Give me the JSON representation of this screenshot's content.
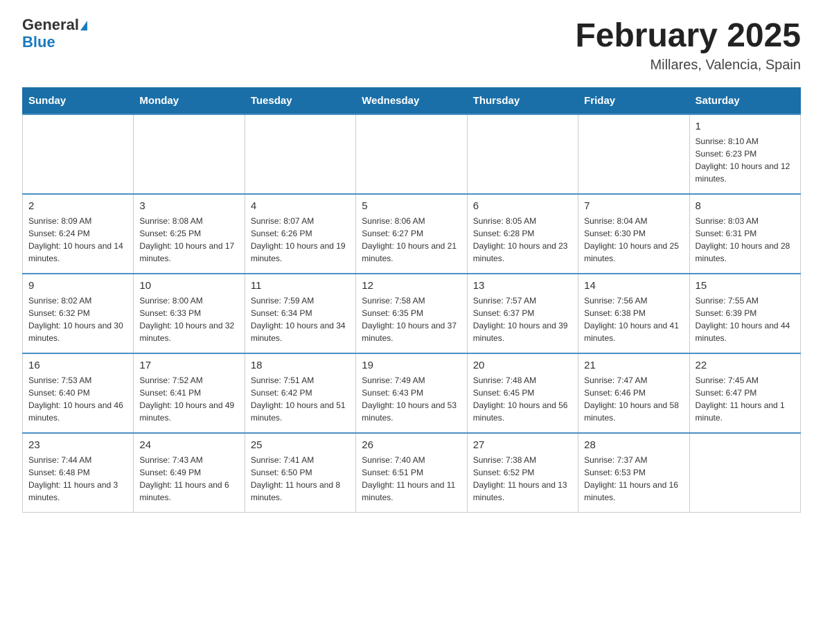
{
  "logo": {
    "line1": "General",
    "line2": "Blue"
  },
  "title": "February 2025",
  "location": "Millares, Valencia, Spain",
  "days_of_week": [
    "Sunday",
    "Monday",
    "Tuesday",
    "Wednesday",
    "Thursday",
    "Friday",
    "Saturday"
  ],
  "weeks": [
    [
      {
        "day": null,
        "sunrise": null,
        "sunset": null,
        "daylight": null
      },
      {
        "day": null,
        "sunrise": null,
        "sunset": null,
        "daylight": null
      },
      {
        "day": null,
        "sunrise": null,
        "sunset": null,
        "daylight": null
      },
      {
        "day": null,
        "sunrise": null,
        "sunset": null,
        "daylight": null
      },
      {
        "day": null,
        "sunrise": null,
        "sunset": null,
        "daylight": null
      },
      {
        "day": null,
        "sunrise": null,
        "sunset": null,
        "daylight": null
      },
      {
        "day": "1",
        "sunrise": "Sunrise: 8:10 AM",
        "sunset": "Sunset: 6:23 PM",
        "daylight": "Daylight: 10 hours and 12 minutes."
      }
    ],
    [
      {
        "day": "2",
        "sunrise": "Sunrise: 8:09 AM",
        "sunset": "Sunset: 6:24 PM",
        "daylight": "Daylight: 10 hours and 14 minutes."
      },
      {
        "day": "3",
        "sunrise": "Sunrise: 8:08 AM",
        "sunset": "Sunset: 6:25 PM",
        "daylight": "Daylight: 10 hours and 17 minutes."
      },
      {
        "day": "4",
        "sunrise": "Sunrise: 8:07 AM",
        "sunset": "Sunset: 6:26 PM",
        "daylight": "Daylight: 10 hours and 19 minutes."
      },
      {
        "day": "5",
        "sunrise": "Sunrise: 8:06 AM",
        "sunset": "Sunset: 6:27 PM",
        "daylight": "Daylight: 10 hours and 21 minutes."
      },
      {
        "day": "6",
        "sunrise": "Sunrise: 8:05 AM",
        "sunset": "Sunset: 6:28 PM",
        "daylight": "Daylight: 10 hours and 23 minutes."
      },
      {
        "day": "7",
        "sunrise": "Sunrise: 8:04 AM",
        "sunset": "Sunset: 6:30 PM",
        "daylight": "Daylight: 10 hours and 25 minutes."
      },
      {
        "day": "8",
        "sunrise": "Sunrise: 8:03 AM",
        "sunset": "Sunset: 6:31 PM",
        "daylight": "Daylight: 10 hours and 28 minutes."
      }
    ],
    [
      {
        "day": "9",
        "sunrise": "Sunrise: 8:02 AM",
        "sunset": "Sunset: 6:32 PM",
        "daylight": "Daylight: 10 hours and 30 minutes."
      },
      {
        "day": "10",
        "sunrise": "Sunrise: 8:00 AM",
        "sunset": "Sunset: 6:33 PM",
        "daylight": "Daylight: 10 hours and 32 minutes."
      },
      {
        "day": "11",
        "sunrise": "Sunrise: 7:59 AM",
        "sunset": "Sunset: 6:34 PM",
        "daylight": "Daylight: 10 hours and 34 minutes."
      },
      {
        "day": "12",
        "sunrise": "Sunrise: 7:58 AM",
        "sunset": "Sunset: 6:35 PM",
        "daylight": "Daylight: 10 hours and 37 minutes."
      },
      {
        "day": "13",
        "sunrise": "Sunrise: 7:57 AM",
        "sunset": "Sunset: 6:37 PM",
        "daylight": "Daylight: 10 hours and 39 minutes."
      },
      {
        "day": "14",
        "sunrise": "Sunrise: 7:56 AM",
        "sunset": "Sunset: 6:38 PM",
        "daylight": "Daylight: 10 hours and 41 minutes."
      },
      {
        "day": "15",
        "sunrise": "Sunrise: 7:55 AM",
        "sunset": "Sunset: 6:39 PM",
        "daylight": "Daylight: 10 hours and 44 minutes."
      }
    ],
    [
      {
        "day": "16",
        "sunrise": "Sunrise: 7:53 AM",
        "sunset": "Sunset: 6:40 PM",
        "daylight": "Daylight: 10 hours and 46 minutes."
      },
      {
        "day": "17",
        "sunrise": "Sunrise: 7:52 AM",
        "sunset": "Sunset: 6:41 PM",
        "daylight": "Daylight: 10 hours and 49 minutes."
      },
      {
        "day": "18",
        "sunrise": "Sunrise: 7:51 AM",
        "sunset": "Sunset: 6:42 PM",
        "daylight": "Daylight: 10 hours and 51 minutes."
      },
      {
        "day": "19",
        "sunrise": "Sunrise: 7:49 AM",
        "sunset": "Sunset: 6:43 PM",
        "daylight": "Daylight: 10 hours and 53 minutes."
      },
      {
        "day": "20",
        "sunrise": "Sunrise: 7:48 AM",
        "sunset": "Sunset: 6:45 PM",
        "daylight": "Daylight: 10 hours and 56 minutes."
      },
      {
        "day": "21",
        "sunrise": "Sunrise: 7:47 AM",
        "sunset": "Sunset: 6:46 PM",
        "daylight": "Daylight: 10 hours and 58 minutes."
      },
      {
        "day": "22",
        "sunrise": "Sunrise: 7:45 AM",
        "sunset": "Sunset: 6:47 PM",
        "daylight": "Daylight: 11 hours and 1 minute."
      }
    ],
    [
      {
        "day": "23",
        "sunrise": "Sunrise: 7:44 AM",
        "sunset": "Sunset: 6:48 PM",
        "daylight": "Daylight: 11 hours and 3 minutes."
      },
      {
        "day": "24",
        "sunrise": "Sunrise: 7:43 AM",
        "sunset": "Sunset: 6:49 PM",
        "daylight": "Daylight: 11 hours and 6 minutes."
      },
      {
        "day": "25",
        "sunrise": "Sunrise: 7:41 AM",
        "sunset": "Sunset: 6:50 PM",
        "daylight": "Daylight: 11 hours and 8 minutes."
      },
      {
        "day": "26",
        "sunrise": "Sunrise: 7:40 AM",
        "sunset": "Sunset: 6:51 PM",
        "daylight": "Daylight: 11 hours and 11 minutes."
      },
      {
        "day": "27",
        "sunrise": "Sunrise: 7:38 AM",
        "sunset": "Sunset: 6:52 PM",
        "daylight": "Daylight: 11 hours and 13 minutes."
      },
      {
        "day": "28",
        "sunrise": "Sunrise: 7:37 AM",
        "sunset": "Sunset: 6:53 PM",
        "daylight": "Daylight: 11 hours and 16 minutes."
      },
      {
        "day": null,
        "sunrise": null,
        "sunset": null,
        "daylight": null
      }
    ]
  ]
}
